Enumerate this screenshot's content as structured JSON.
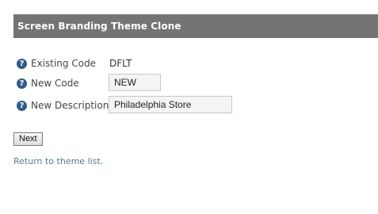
{
  "header": {
    "title": "Screen Branding Theme Clone"
  },
  "form": {
    "existing_code": {
      "label": "Existing Code",
      "value": "DFLT",
      "icon": "help-icon"
    },
    "new_code": {
      "label": "New Code",
      "value": "NEW",
      "icon": "help-icon"
    },
    "new_description": {
      "label": "New Description",
      "value": "Philadelphia Store",
      "icon": "help-icon"
    }
  },
  "actions": {
    "next_label": "Next",
    "return_link": "Return to theme list."
  },
  "colors": {
    "header_bg": "#747474",
    "help_icon": "#2f5b8a",
    "link": "#5a7a8a"
  }
}
